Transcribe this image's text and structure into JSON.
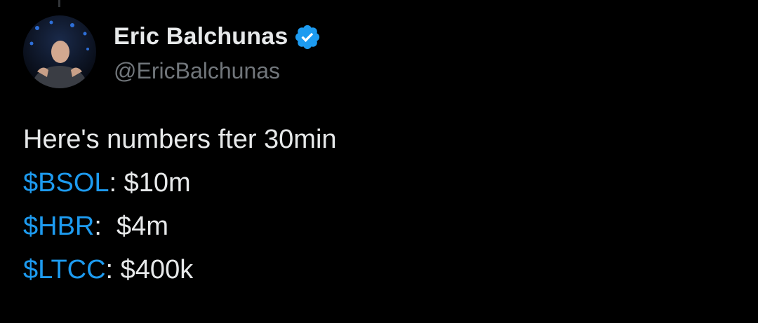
{
  "author": {
    "display_name": "Eric Balchunas",
    "handle": "@EricBalchunas",
    "avatar_icon": "profile-photo-icon",
    "verified_icon": "verified-badge-icon",
    "verified_color": "#1d9bf0"
  },
  "tweet": {
    "intro": "Here's numbers fter 30min",
    "lines": [
      {
        "cashtag": "$BSOL",
        "rest": ": $10m"
      },
      {
        "cashtag": "$HBR",
        "rest": ":  $4m"
      },
      {
        "cashtag": "$LTCC",
        "rest": ": $400k"
      }
    ]
  },
  "colors": {
    "background": "#000000",
    "text": "#e7e9ea",
    "secondary_text": "#71767b",
    "link": "#1d9bf0"
  }
}
